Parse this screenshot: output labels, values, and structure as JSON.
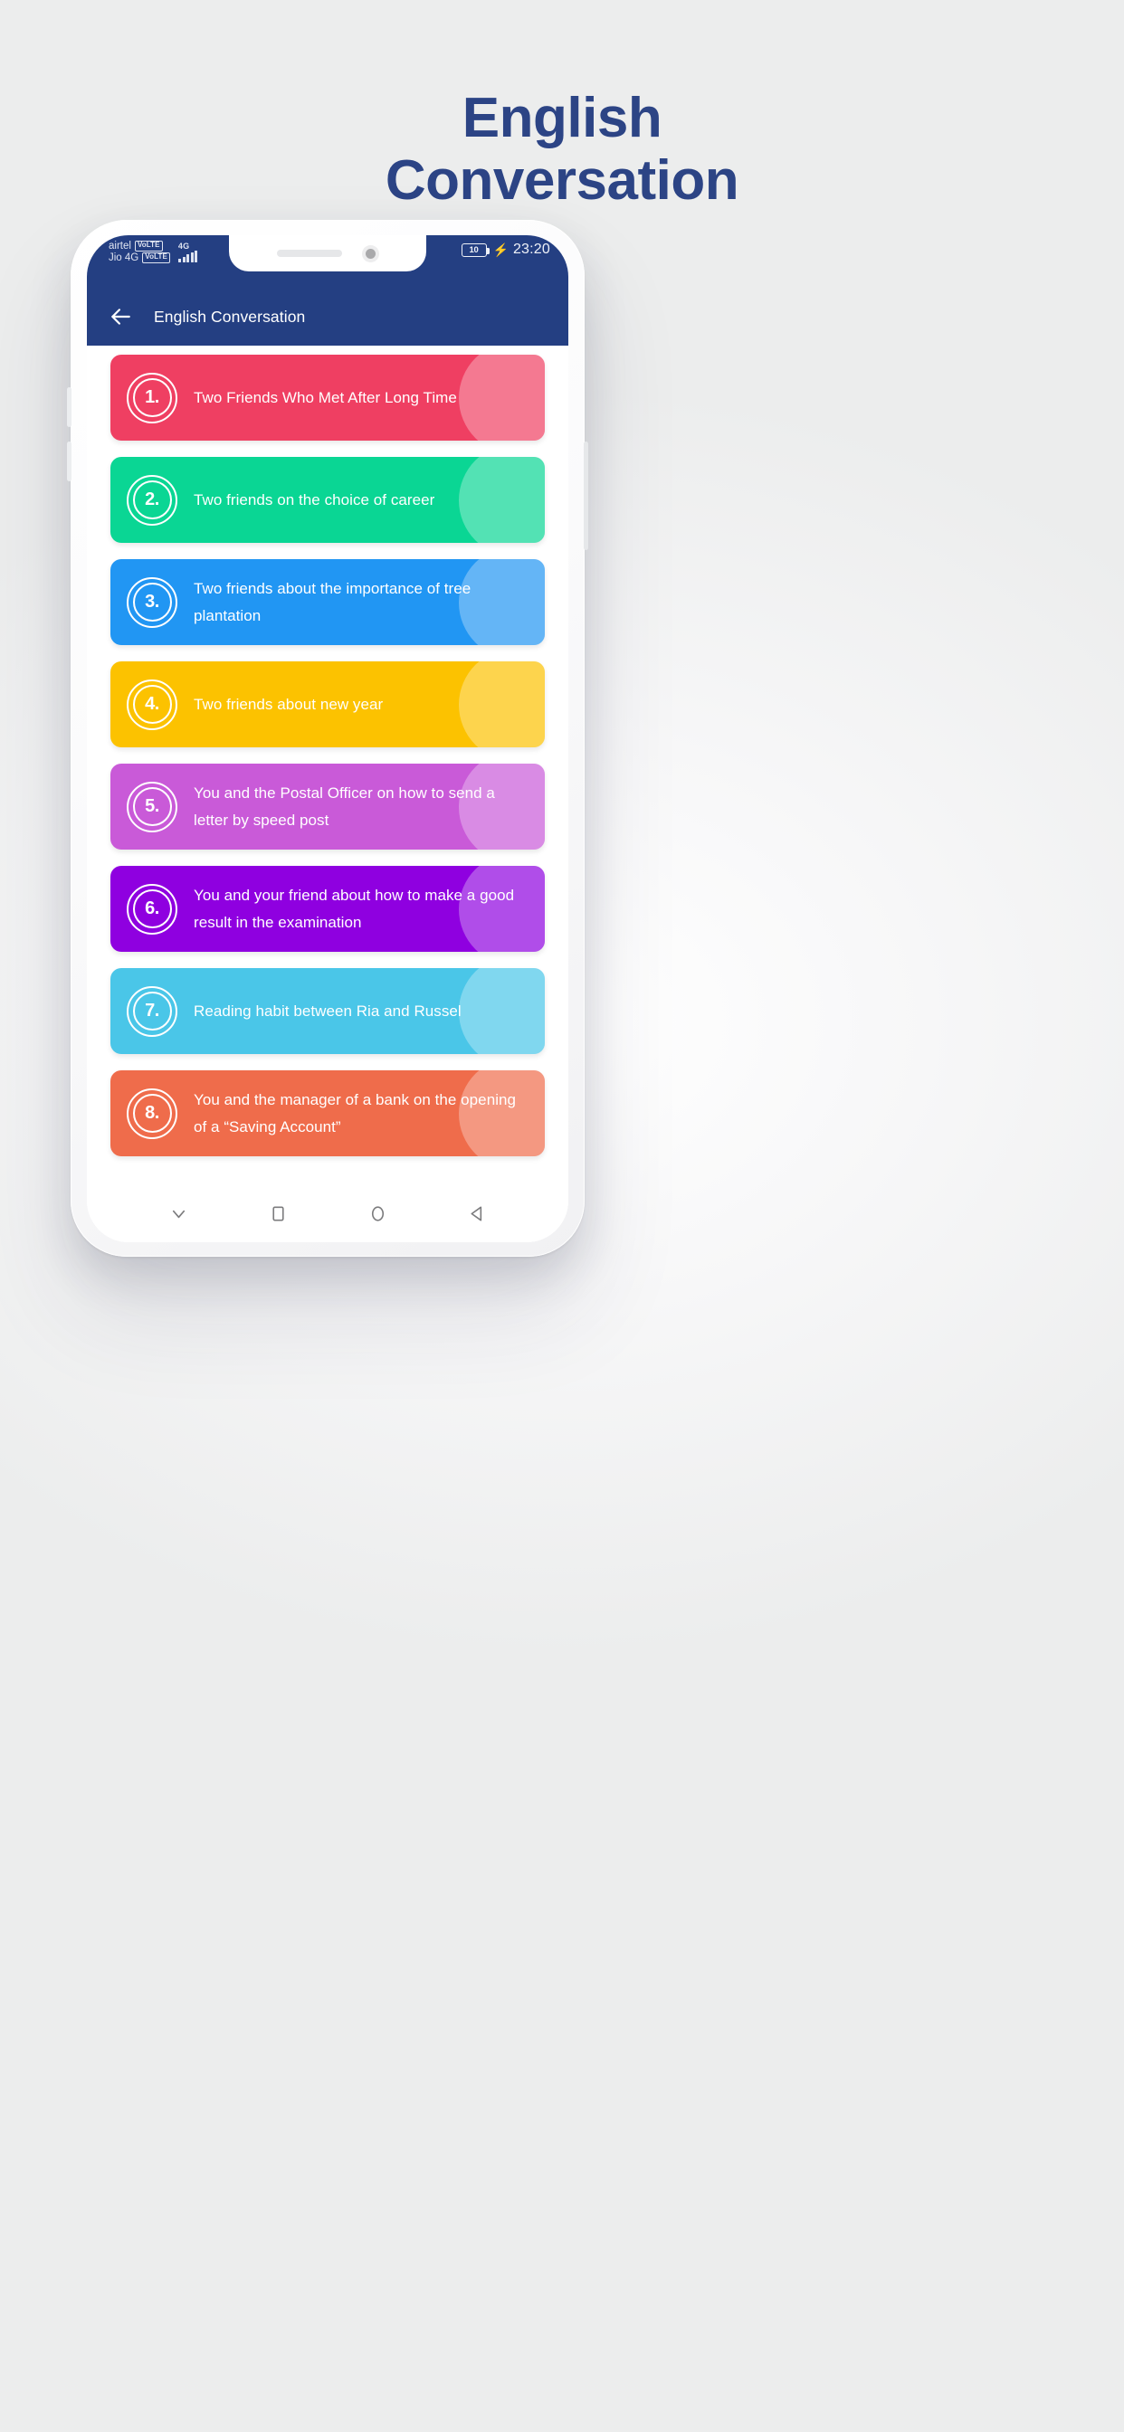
{
  "promo": {
    "title_line1": "English",
    "title_line2": "Conversation",
    "title_color": "#2c4485"
  },
  "phone": {
    "status_bar": {
      "carrier_1": "airtel",
      "carrier_1_badge": "VoLTE",
      "carrier_2": "Jio 4G",
      "carrier_2_badge": "VoLTE",
      "network_generation": "4G",
      "signal_icon": "signal-bars-icon",
      "battery_level": "10",
      "charging_icon": "charging-bolt-icon",
      "time": "23:20",
      "background_color": "#243f82"
    },
    "app_bar": {
      "back_icon": "back-arrow-icon",
      "title": "English Conversation",
      "background_color": "#243f82"
    },
    "topics": [
      {
        "number": "1.",
        "label": "Two Friends Who Met After Long Time",
        "color": "#ef3f62"
      },
      {
        "number": "2.",
        "label": "Two friends on the choice of career",
        "color": "#0ad694"
      },
      {
        "number": "3.",
        "label": "Two friends about the importance of tree plantation",
        "color": "#2196f3"
      },
      {
        "number": "4.",
        "label": "Two friends about new year",
        "color": "#fcc200"
      },
      {
        "number": "5.",
        "label": "You and the Postal Officer on how to send a letter by speed post",
        "color": "#c95ad8"
      },
      {
        "number": "6.",
        "label": "You and your friend about how to make a good result in the examination",
        "color": "#8f00e0"
      },
      {
        "number": "7.",
        "label": "Reading habit between Ria and Russel",
        "color": "#4ac6e8"
      },
      {
        "number": "8.",
        "label": "You and the manager of a bank on the opening of a “Saving Account”",
        "color": "#ef6c4b"
      }
    ],
    "nav_bar": {
      "hide_keyboard_icon": "chevron-down-icon",
      "recents_icon": "square-icon",
      "home_icon": "circle-icon",
      "back_icon": "triangle-left-icon"
    }
  }
}
